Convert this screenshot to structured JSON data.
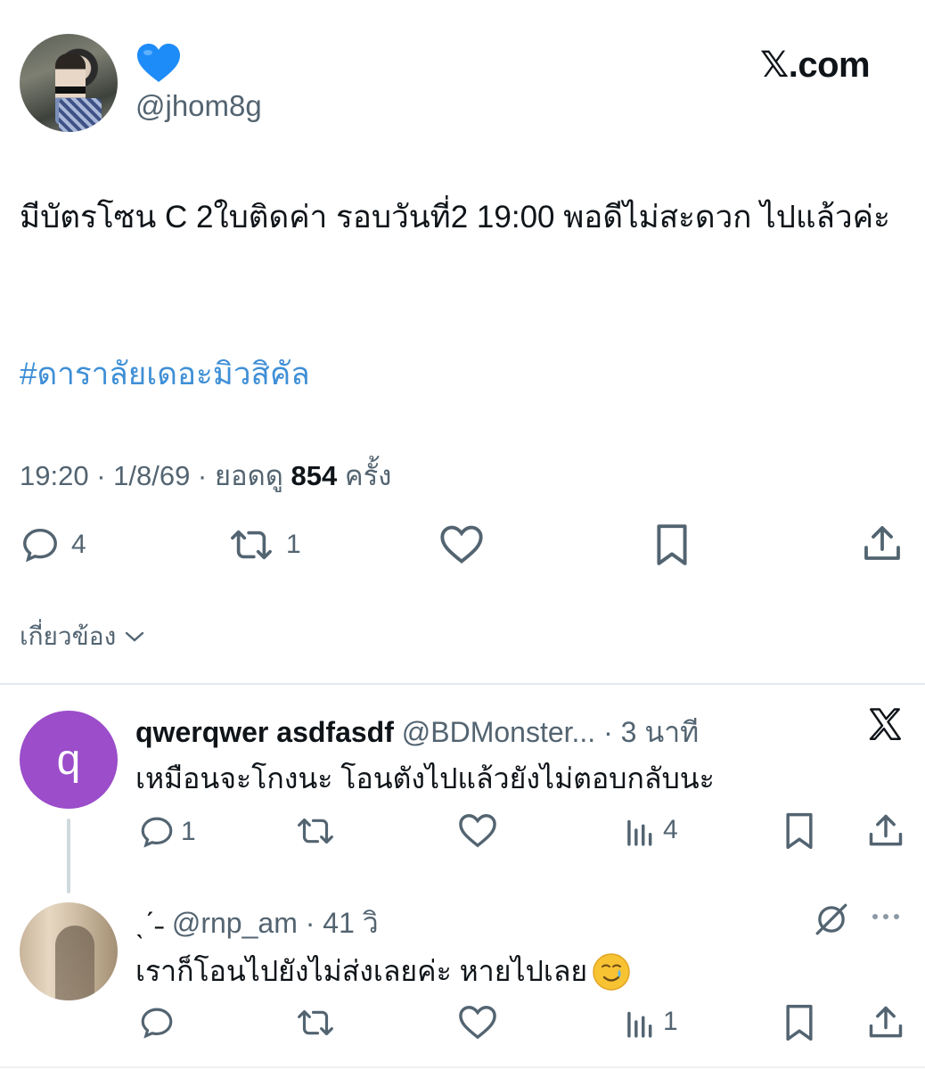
{
  "main_tweet": {
    "display_name_emoji": "💙",
    "handle": "@jhom8g",
    "brand": "𝕏.com",
    "text": "มีบัตรโซน C 2ใบติดค่า รอบวันที่2 19:00 พอดีไม่สะดวก ไปแล้วค่ะ",
    "hashtag": "#ดาราลัยเดอะมิวสิคัล",
    "time": "19:20 · 1/8/69 · ยอดดู ",
    "views": "854",
    "views_suffix": " ครั้ง",
    "replies": "4",
    "reposts": "1",
    "related_label": "เกี่ยวข้อง"
  },
  "reply_1": {
    "avatar_letter": "q",
    "name": "qwerqwer asdfasdf",
    "handle_time": " @BDMonster... · 3 นาที",
    "text": "เหมือนจะโกงนะ โอนตังไปแล้วยังไม่ตอบกลับนะ",
    "replies": "1",
    "views": "4"
  },
  "reply_2": {
    "name": "ˎˊ˗",
    "handle_time": " @rnp_am · 41 วิ",
    "text": "เราก็โอนไปยังไม่ส่งเลยค่ะ หายไปเลย",
    "views": "1"
  },
  "colors": {
    "hashtag": "#3f8fd6",
    "muted": "#536471",
    "text": "#0f1419",
    "avatar_q": "#9b4dca",
    "heart_blue": "#1d8cf8"
  }
}
